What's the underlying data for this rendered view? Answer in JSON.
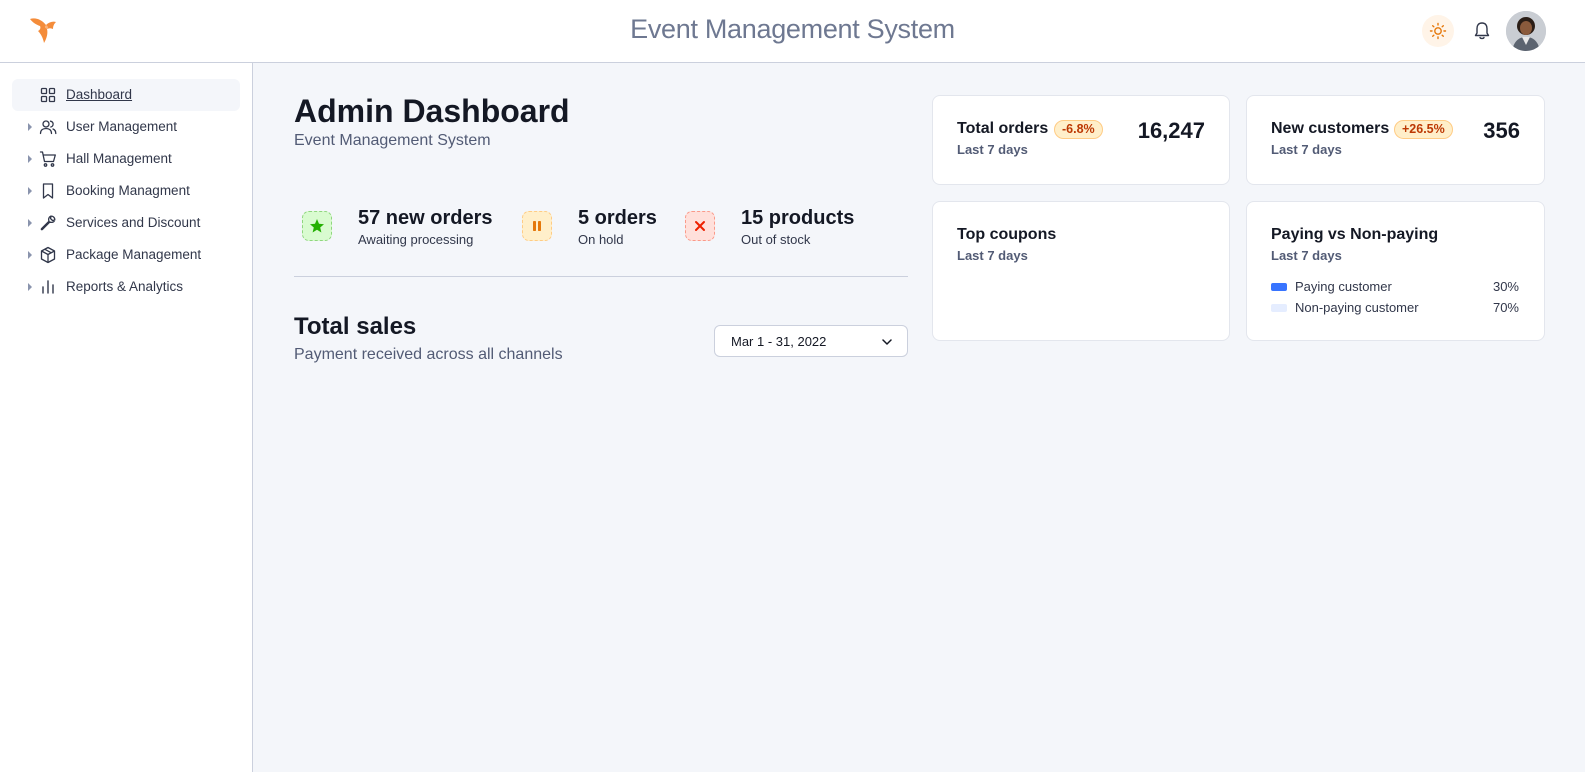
{
  "header": {
    "app_title": "Event Management System",
    "logo_icon": "fox-logo-icon",
    "theme_icon": "sun-icon",
    "notification_icon": "bell-icon"
  },
  "sidebar": {
    "items": [
      {
        "label": "Dashboard",
        "icon": "grid-icon",
        "active": true
      },
      {
        "label": "User Management",
        "icon": "users-icon"
      },
      {
        "label": "Hall Management",
        "icon": "cart-icon"
      },
      {
        "label": "Booking Managment",
        "icon": "bookmark-icon"
      },
      {
        "label": "Services and Discount",
        "icon": "wrench-icon"
      },
      {
        "label": "Package Management",
        "icon": "package-icon"
      },
      {
        "label": "Reports & Analytics",
        "icon": "bar-chart-icon"
      }
    ]
  },
  "main": {
    "title": "Admin Dashboard",
    "subtitle": "Event Management System",
    "stats": [
      {
        "value": "57 new orders",
        "caption": "Awaiting processing",
        "icon": "star-icon",
        "color": "#25b003"
      },
      {
        "value": "5 orders",
        "caption": "On hold",
        "icon": "pause-icon",
        "color": "#e5780b"
      },
      {
        "value": "15 products",
        "caption": "Out of stock",
        "icon": "x-icon",
        "color": "#ed2000"
      }
    ],
    "sales": {
      "title": "Total sales",
      "subtitle": "Payment received across all channels",
      "date_range": "Mar 1 - 31, 2022"
    }
  },
  "cards": {
    "total_orders": {
      "title": "Total orders",
      "delta": "-6.8%",
      "value": "16,247",
      "period": "Last 7 days"
    },
    "new_customers": {
      "title": "New customers",
      "delta": "+26.5%",
      "value": "356",
      "period": "Last 7 days"
    },
    "top_coupons": {
      "title": "Top coupons",
      "period": "Last 7 days"
    },
    "paying": {
      "title": "Paying vs Non-paying",
      "period": "Last 7 days",
      "legend": [
        {
          "label": "Paying customer",
          "percent": "30%",
          "color": "#3874ff"
        },
        {
          "label": "Non-paying customer",
          "percent": "70%",
          "color": "#e5edff"
        }
      ]
    }
  },
  "colors": {
    "accent": "#3874ff",
    "logo": "#f48c3a",
    "warning_bg": "#ffefca"
  }
}
